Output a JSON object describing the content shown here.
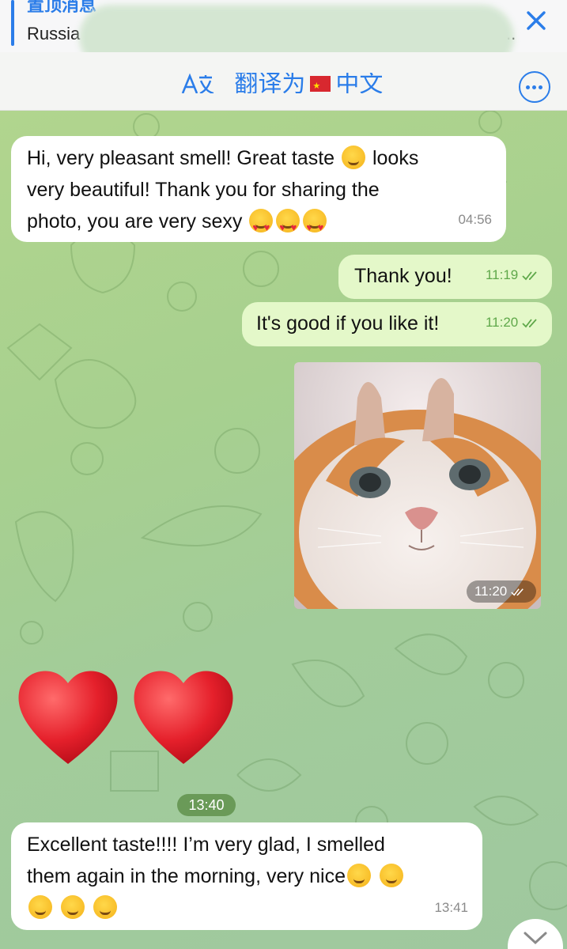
{
  "pinned": {
    "title": "置顶消息",
    "text": "Russia",
    "ellipsis": ".."
  },
  "translate_bar": {
    "label": "翻译为",
    "language": "中文",
    "icon": "translate-icon",
    "more_icon": "more-options-icon"
  },
  "messages": [
    {
      "id": "m1",
      "direction": "incoming",
      "lines": [
        "Hi, very pleasant smell! Great taste",
        "looks",
        "very beautiful! Thank you for sharing the",
        "photo, you are very sexy"
      ],
      "time": "04:56"
    },
    {
      "id": "m2",
      "direction": "outgoing",
      "text": "Thank you!",
      "time": "11:19"
    },
    {
      "id": "m3",
      "direction": "outgoing",
      "text": "It's good if you like it!",
      "time": "11:20"
    },
    {
      "id": "m4",
      "direction": "outgoing",
      "type": "photo",
      "time": "11:20"
    },
    {
      "id": "m5",
      "direction": "incoming",
      "type": "sticker",
      "content": "two red hearts"
    },
    {
      "id": "m6",
      "direction": "incoming",
      "lines": [
        "Excellent taste!!!! I’m very glad, I smelled",
        "them again in the morning, very nice"
      ],
      "time": "13:41"
    }
  ],
  "date_pill": "13:40",
  "colors": {
    "accent": "#2b7de9",
    "incoming_bubble": "#ffffff",
    "outgoing_bubble": "#e4f8c9",
    "outgoing_time": "#5fa84a"
  }
}
